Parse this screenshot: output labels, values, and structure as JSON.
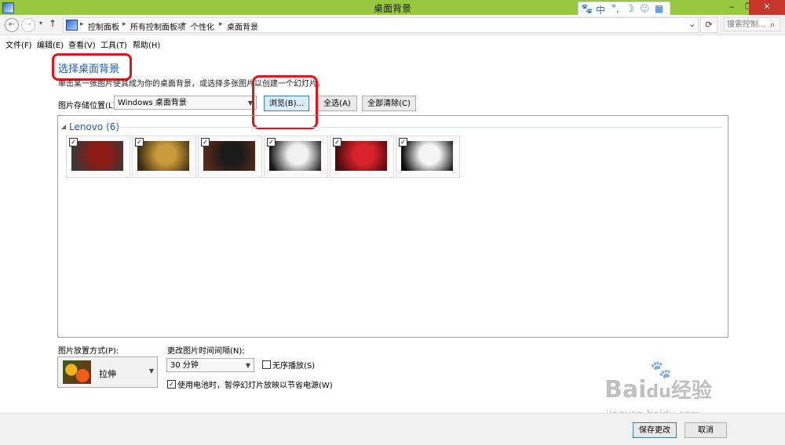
{
  "window": {
    "title": "桌面背景",
    "minimize": "‒",
    "maximize": "❐",
    "close": "✕"
  },
  "ime": {
    "items": [
      "🐾",
      "中",
      "°,",
      "☽",
      "☺",
      "▦"
    ]
  },
  "address": {
    "back": "←",
    "forward": "→",
    "up": "↑",
    "crumbs": [
      "控制面板",
      "所有控制面板项",
      "个性化",
      "桌面背景"
    ],
    "dropdown": "⌄",
    "refresh": "⟳",
    "search_placeholder": "搜索控制...",
    "search_icon": "⌕"
  },
  "menu": [
    "文件(F)",
    "编辑(E)",
    "查看(V)",
    "工具(T)",
    "帮助(H)"
  ],
  "main": {
    "heading": "选择桌面背景",
    "description": "单击某一张图片使其成为你的桌面背景，或选择多张图片以创建一个幻灯片。",
    "location_label": "图片存储位置(L):",
    "location_value": "Windows 桌面背景",
    "browse": "浏览(B)...",
    "select_all": "全选(A)",
    "clear_all": "全部清除(C)"
  },
  "gallery": {
    "group": "Lenovo (6)",
    "group_arrow": "◢",
    "check": "✓",
    "images": [
      {
        "colors": [
          "#8a1a12",
          "#3a3a3a"
        ]
      },
      {
        "colors": [
          "#c79a3a",
          "#3d2a10"
        ]
      },
      {
        "colors": [
          "#1a1a1a",
          "#5a2a1a"
        ]
      },
      {
        "colors": [
          "#f0f0f0",
          "#1a1a1a"
        ]
      },
      {
        "colors": [
          "#d8232a",
          "#4a0a0a"
        ]
      },
      {
        "colors": [
          "#f5f5f5",
          "#0d0d0d"
        ]
      }
    ]
  },
  "bottom": {
    "position_label": "图片放置方式(P):",
    "position_value": "拉伸",
    "interval_label": "更改图片时间间隔(N):",
    "interval_value": "30 分钟",
    "shuffle_label": "无序播放(S)",
    "battery_label": "使用电池时，暂停幻灯片放映以节省电源(W)",
    "save": "保存更改",
    "cancel": "取消"
  },
  "watermark": {
    "brand": "Bai",
    "brand2": "du",
    "text": "经验",
    "url": "jingyan.baidu.com"
  },
  "colors": {
    "titlebar": "#97c840",
    "accent": "#1e5cbb",
    "annotation": "#e8101b"
  }
}
